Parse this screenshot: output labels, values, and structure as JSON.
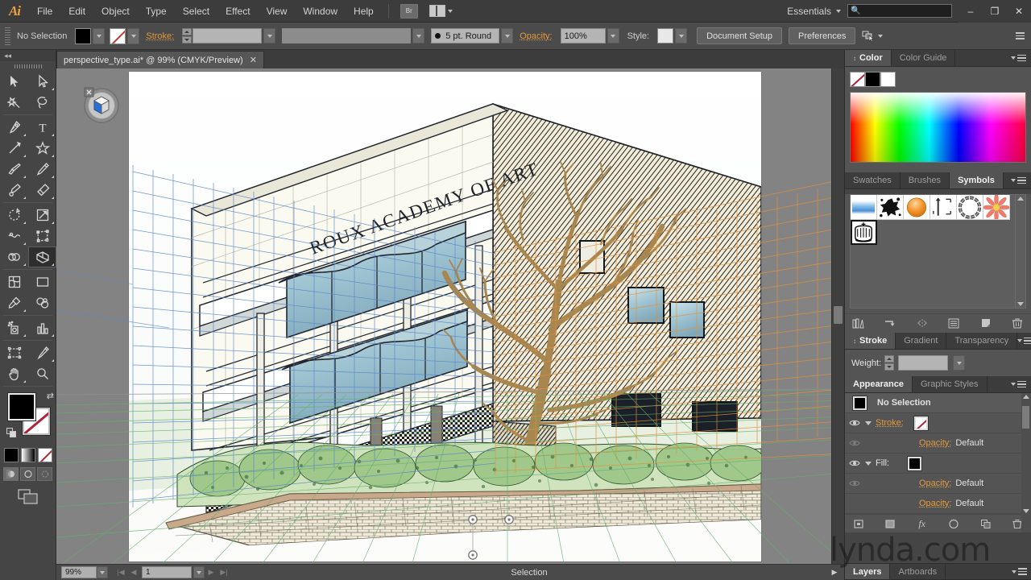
{
  "app": {
    "name": "Adobe Illustrator",
    "logo": "Ai"
  },
  "menubar": {
    "items": [
      "File",
      "Edit",
      "Object",
      "Type",
      "Select",
      "Effect",
      "View",
      "Window",
      "Help"
    ],
    "bridge_label": "Br",
    "workspace": "Essentials",
    "search_placeholder": "",
    "window_buttons": {
      "minimize": "–",
      "restore": "❐",
      "close": "✕"
    }
  },
  "controlbar": {
    "selection_status": "No Selection",
    "fill_color": "#000000",
    "stroke_label": "Stroke:",
    "stroke_weight": "",
    "stroke_profile": "",
    "brush_def": "5 pt. Round",
    "opacity_label": "Opacity:",
    "opacity_value": "100%",
    "style_label": "Style:",
    "document_setup": "Document Setup",
    "preferences": "Preferences"
  },
  "tabs": [
    {
      "title": "perspective_type.ai* @ 99% (CMYK/Preview)",
      "close": "✕",
      "active": true
    }
  ],
  "toolbar": {
    "collapse": "◂◂",
    "tools": [
      {
        "name": "selection-tool",
        "group": 0
      },
      {
        "name": "direct-selection-tool",
        "group": 0
      },
      {
        "name": "magic-wand-tool",
        "group": 0
      },
      {
        "name": "lasso-tool",
        "group": 0
      },
      {
        "name": "pen-tool",
        "group": 1
      },
      {
        "name": "type-tool",
        "group": 1
      },
      {
        "name": "line-segment-tool",
        "group": 1
      },
      {
        "name": "shape-tool",
        "group": 1
      },
      {
        "name": "paintbrush-tool",
        "group": 1
      },
      {
        "name": "pencil-tool",
        "group": 1
      },
      {
        "name": "blob-brush-tool",
        "group": 1
      },
      {
        "name": "eraser-tool",
        "group": 1
      },
      {
        "name": "rotate-tool",
        "group": 2
      },
      {
        "name": "scale-tool",
        "group": 2
      },
      {
        "name": "width-tool",
        "group": 2
      },
      {
        "name": "free-transform-tool",
        "group": 2
      },
      {
        "name": "shape-builder-tool",
        "group": 2
      },
      {
        "name": "perspective-grid-tool",
        "group": 2,
        "selected": true
      },
      {
        "name": "mesh-tool",
        "group": 3
      },
      {
        "name": "gradient-tool",
        "group": 3
      },
      {
        "name": "eyedropper-tool",
        "group": 3
      },
      {
        "name": "blend-tool",
        "group": 3
      },
      {
        "name": "symbol-sprayer-tool",
        "group": 4
      },
      {
        "name": "column-graph-tool",
        "group": 4
      },
      {
        "name": "artboard-tool",
        "group": 5
      },
      {
        "name": "slice-tool",
        "group": 5
      },
      {
        "name": "hand-tool",
        "group": 5
      },
      {
        "name": "zoom-tool",
        "group": 5
      }
    ],
    "fill_color": "#000000",
    "stroke_color": "none",
    "modes": [
      "color-mode",
      "gradient-mode",
      "none-mode"
    ],
    "draw_modes": [
      "draw-normal",
      "draw-behind",
      "draw-inside"
    ],
    "screen_mode": "change-screen-mode"
  },
  "canvas": {
    "artwork_title": "ROUX ACADEMY OF ART",
    "perspective_widget": "plane-switching-widget",
    "active_plane": "left",
    "grid_colors": {
      "left": "#4a7fc4",
      "right": "#e0892a",
      "horizontal": "#5faa6a"
    }
  },
  "statusbar": {
    "zoom": "99%",
    "artboard_number": "1",
    "status_text": "Selection"
  },
  "panels": {
    "color": {
      "tabs": [
        "Color",
        "Color Guide"
      ],
      "active": "Color",
      "swatches": [
        "none",
        "#000000",
        "#ffffff"
      ]
    },
    "symbols": {
      "tabs": [
        "Swatches",
        "Brushes",
        "Symbols"
      ],
      "active": "Symbols",
      "items": [
        {
          "name": "sky-symbol",
          "label": "Sky"
        },
        {
          "name": "splatter-symbol",
          "label": "Splatter"
        },
        {
          "name": "orange-sphere-symbol",
          "label": "Sphere"
        },
        {
          "name": "arrows-symbol",
          "label": "Arrows"
        },
        {
          "name": "ring-symbol",
          "label": "Ring"
        },
        {
          "name": "flower-symbol",
          "label": "Flower"
        },
        {
          "name": "crown-symbol",
          "label": "Crown",
          "selected": true
        }
      ],
      "footer_buttons": [
        "symbol-libraries",
        "place-instance",
        "break-link",
        "symbol-options",
        "new-symbol",
        "delete-symbol"
      ]
    },
    "stroke": {
      "tabs": [
        "Stroke",
        "Gradient",
        "Transparency"
      ],
      "active": "Stroke",
      "weight_label": "Weight:",
      "weight_value": ""
    },
    "appearance": {
      "tabs": [
        "Appearance",
        "Graphic Styles"
      ],
      "active": "Appearance",
      "rows": [
        {
          "name": "appearance-target",
          "label": "No Selection",
          "type": "header",
          "swatch": "#000000"
        },
        {
          "name": "appearance-stroke",
          "label": "Stroke:",
          "type": "stroke",
          "swatch": "none"
        },
        {
          "name": "appearance-stroke-opacity",
          "label": "Opacity:",
          "value": "Default",
          "type": "opacity"
        },
        {
          "name": "appearance-fill",
          "label": "Fill:",
          "type": "fill",
          "swatch": "#000000"
        },
        {
          "name": "appearance-fill-opacity",
          "label": "Opacity:",
          "value": "Default",
          "type": "opacity"
        },
        {
          "name": "appearance-object-opacity",
          "label": "Opacity:",
          "value": "Default",
          "type": "opacity"
        }
      ],
      "footer_buttons": [
        "add-new-stroke",
        "add-new-fill",
        "add-effect",
        "clear-appearance",
        "duplicate-item",
        "delete-item"
      ]
    },
    "layers": {
      "tabs": [
        "Layers",
        "Artboards"
      ],
      "active": "Layers"
    }
  },
  "watermark": "lynda.com"
}
